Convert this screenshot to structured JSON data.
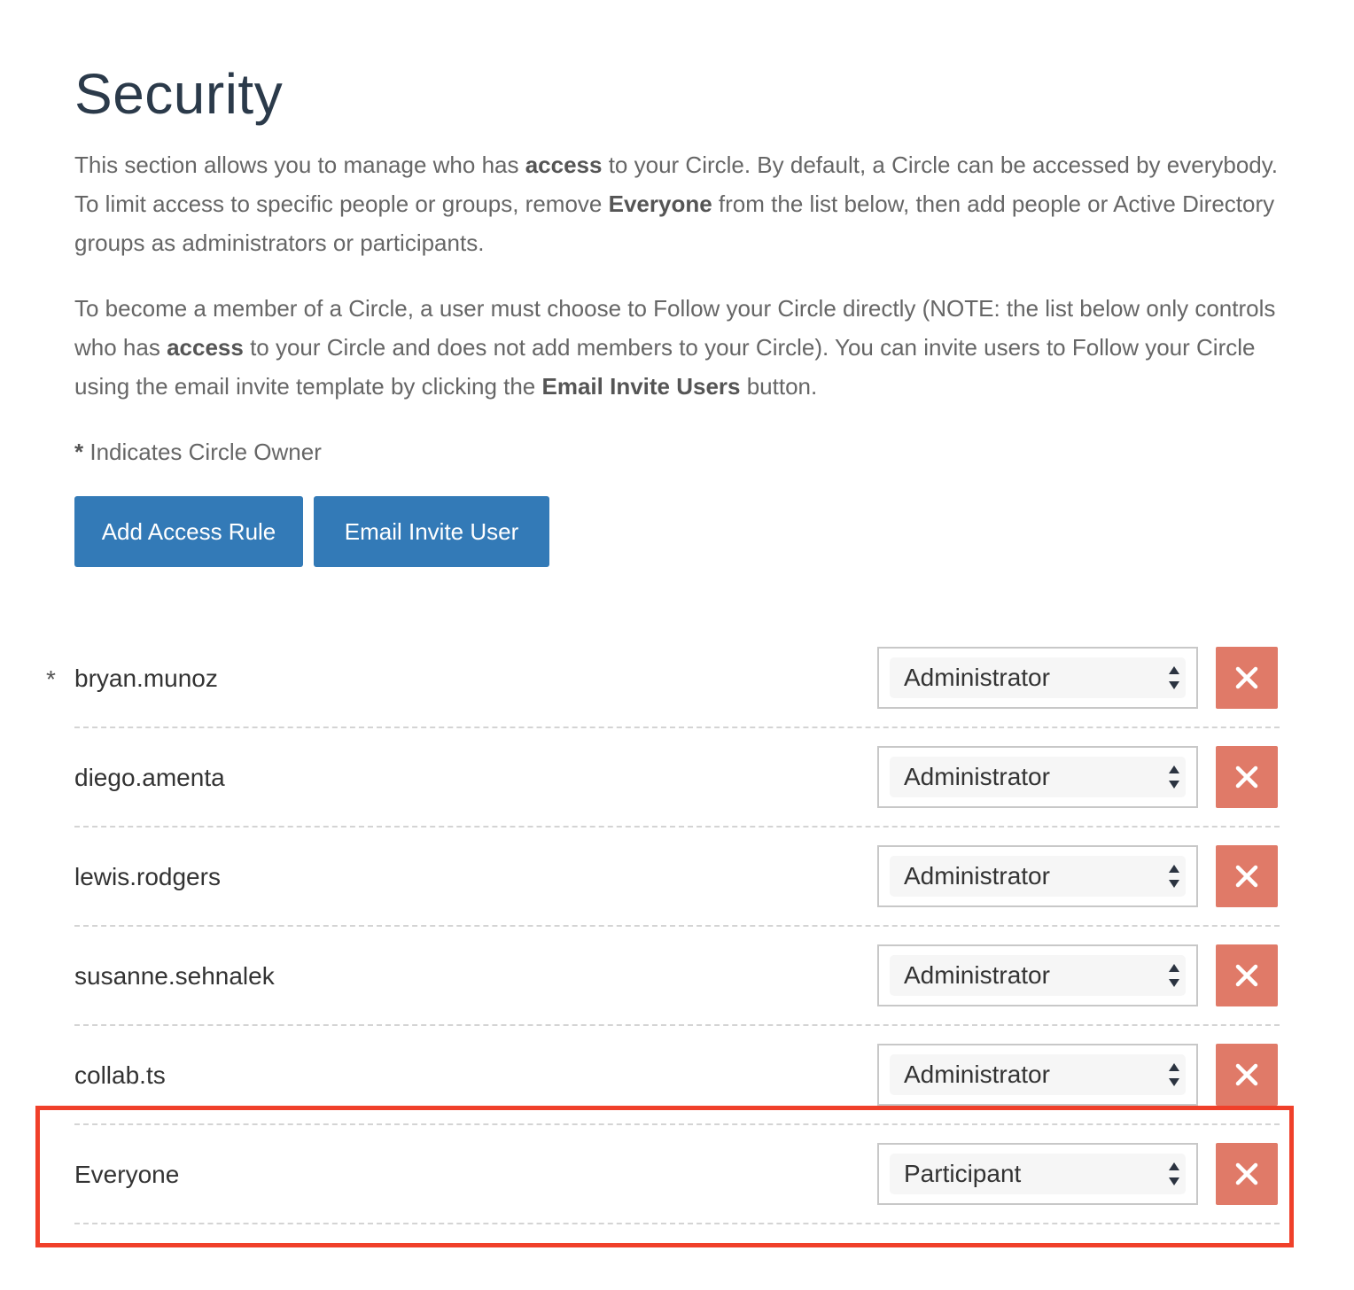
{
  "page": {
    "title": "Security"
  },
  "intro": {
    "p1_a": "This section allows you to manage who has ",
    "p1_b1": "access",
    "p1_c": " to your Circle. By default, a Circle can be accessed by everybody. To limit access to specific people or groups, remove ",
    "p1_b2": "Everyone",
    "p1_d": " from the list below, then add people or Active Directory groups as administrators or participants.",
    "p2_a": "To become a member of a Circle, a user must choose to Follow your Circle directly (NOTE: the list below only controls who has ",
    "p2_b1": "access",
    "p2_c": " to your Circle and does not add members to your Circle). You can invite users to Follow your Circle using the email invite template by clicking the ",
    "p2_b2": "Email Invite Users",
    "p2_d": " button."
  },
  "owner_note": {
    "star": "*",
    "text": " Indicates Circle Owner"
  },
  "buttons": {
    "add_access_rule": "Add Access Rule",
    "email_invite_user": "Email Invite User"
  },
  "rules": [
    {
      "name": "bryan.munoz",
      "role": "Administrator",
      "owner_mark": "*"
    },
    {
      "name": "diego.amenta",
      "role": "Administrator",
      "owner_mark": ""
    },
    {
      "name": "lewis.rodgers",
      "role": "Administrator",
      "owner_mark": ""
    },
    {
      "name": "susanne.sehnalek",
      "role": "Administrator",
      "owner_mark": ""
    },
    {
      "name": "collab.ts",
      "role": "Administrator",
      "owner_mark": ""
    },
    {
      "name": "Everyone",
      "role": "Participant",
      "owner_mark": ""
    }
  ],
  "icons": {
    "select_arrows": "updown-arrows-icon",
    "remove": "close-icon"
  },
  "colors": {
    "primary_button": "#337ab7",
    "remove_button": "#e07a68",
    "highlight": "#f0402a",
    "title": "#2b3a4a"
  }
}
